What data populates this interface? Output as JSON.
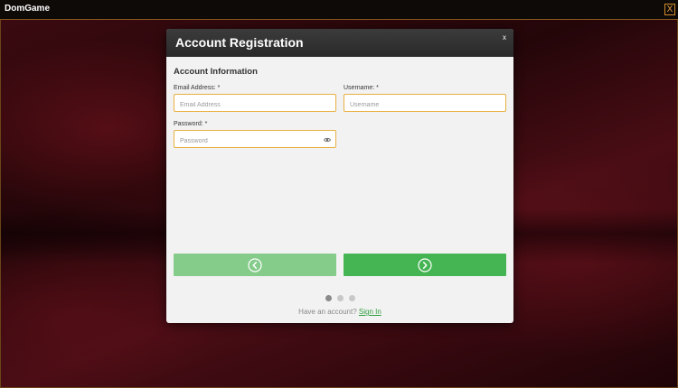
{
  "window": {
    "title": "DomGame",
    "close_label": "X"
  },
  "modal": {
    "title": "Account Registration",
    "close_label": "x",
    "section_title": "Account Information",
    "fields": {
      "email": {
        "label": "Email Address: *",
        "placeholder": "Email Address",
        "value": ""
      },
      "username": {
        "label": "Username: *",
        "placeholder": "Username",
        "value": ""
      },
      "password": {
        "label": "Password: *",
        "placeholder": "Password",
        "value": ""
      }
    },
    "pager": {
      "total_steps": 3,
      "active_step": 1
    },
    "footer": {
      "prompt": "Have an account?",
      "link": "Sign In"
    }
  },
  "colors": {
    "accent_green": "#45b553",
    "accent_green_disabled": "#85cc8b",
    "field_border": "#e8b040",
    "frame_border": "#8a5a1e"
  },
  "icons": {
    "password_toggle": "eye-icon",
    "prev": "chevron-left-circle-icon",
    "next": "chevron-right-circle-icon"
  }
}
